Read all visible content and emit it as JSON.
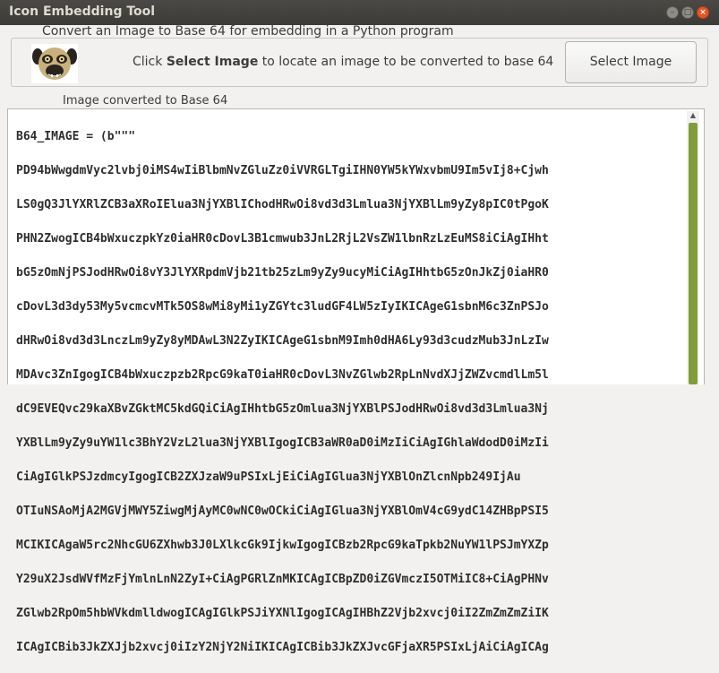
{
  "window": {
    "title": "Icon Embedding Tool"
  },
  "header": {
    "subtitle": "Convert an Image to Base 64 for embedding in a Python program",
    "prompt_pre": "Click ",
    "prompt_bold": "Select Image",
    "prompt_post": " to locate an image to be converted to base 64",
    "select_button": "Select Image"
  },
  "output": {
    "label": "Image converted to Base 64",
    "lines": [
      "B64_IMAGE = (b\"\"\"",
      "PD94bWwgdmVyc2lvbj0iMS4wIiBlbmNvZGluZz0iVVRGLTgiIHN0YW5kYWxvbmU9Im5vIj8+Cjwh",
      "LS0gQ3JlYXRlZCB3aXRoIElua3NjYXBlIChodHRwOi8vd3d3Lmlua3NjYXBlLm9yZy8pIC0tPgoK",
      "PHN2ZwogICB4bWxuczpkYz0iaHR0cDovL3B1cmwub3JnL2RjL2VsZW1lbnRzLzEuMS8iCiAgIHht",
      "bG5zOmNjPSJodHRwOi8vY3JlYXRpdmVjb21tb25zLm9yZy9ucyMiCiAgIHhtbG5zOnJkZj0iaHR0",
      "cDovL3d3dy53My5vcmcvMTk5OS8wMi8yMi1yZGYtc3ludGF4LW5zIyIKICAgeG1sbnM6c3ZnPSJo",
      "dHRwOi8vd3d3LnczLm9yZy8yMDAwL3N2ZyIKICAgeG1sbnM9Imh0dHA6Ly93d3cudzMub3JnLzIw",
      "MDAvc3ZnIgogICB4bWxuczpzb2RpcG9kaT0iaHR0cDovL3NvZGlwb2RpLnNvdXJjZWZvcmdlLm5l",
      "dC9EVEQvc29kaXBvZGktMC5kdGQiCiAgIHhtbG5zOmlua3NjYXBlPSJodHRwOi8vd3d3Lmlua3Nj",
      "YXBlLm9yZy9uYW1lc3BhY2VzL2lua3NjYXBlIgogICB3aWR0aD0iMzIiCiAgIGhlaWdodD0iMzIi",
      "CiAgIGlkPSJzdmcyIgogICB2ZXJzaW9uPSIxLjEiCiAgIGlua3NjYXBlOnZlcnNpb249IjAu",
      "OTIuNSAoMjA2MGVjMWY5ZiwgMjAyMC0wNC0wOCkiCiAgIGlua3NjYXBlOmV4cG9ydC14ZHBpPSI5",
      "MCIKICAgaW5rc2NhcGU6ZXhwb3J0LXlkcGk9IjkwIgogICBzb2RpcG9kaTpkb2NuYW1lPSJmYXZp",
      "Y29uX2JsdWVfMzFjYmlnLnN2ZyI+CiAgPGRlZnMKICAgICBpZD0iZGVmczI5OTMiIC8+CiAgPHNv",
      "ZGlwb2RpOm5hbWVkdmlldwogICAgIGlkPSJiYXNlIgogICAgIHBhZ2Vjb2xvcj0iI2ZmZmZmZiIK",
      "ICAgICBib3JkZXJjb2xvcj0iIzY2NjY2NiIKICAgICBib3JkZXJvcGFjaXR5PSIxLjAiCiAgICAg",
      "aW5rc2NhcGU6cGFnZW9wYWNpdHk9IjAuMCIKICAgICBpbmtzY2FwZTpwYWdlc2hhZG93PSIyIgog"
    ]
  },
  "colors": {
    "accent_close": "#e95420",
    "scrollbar_thumb": "#7f9e3a",
    "titlebar": "#3c3b37"
  },
  "icons": {
    "app_logo": "pug-dog-face-icon"
  }
}
